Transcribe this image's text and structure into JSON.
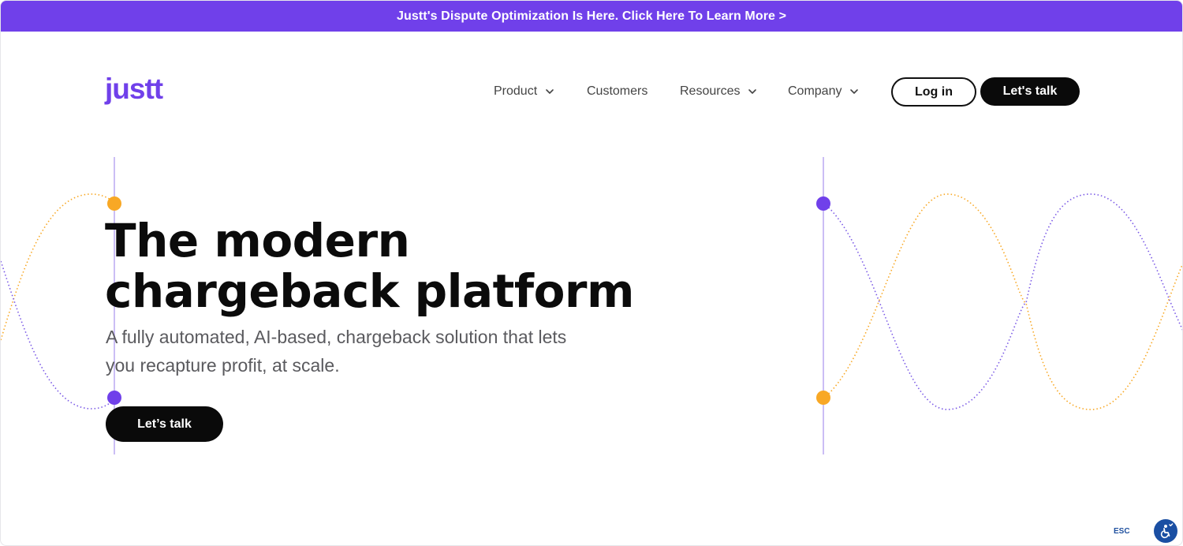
{
  "announcement": {
    "text": "Justt's Dispute Optimization Is Here. Click Here To Learn More >"
  },
  "header": {
    "logo": "justt",
    "nav": [
      {
        "label": "Product",
        "has_dropdown": true
      },
      {
        "label": "Customers",
        "has_dropdown": false
      },
      {
        "label": "Resources",
        "has_dropdown": true
      },
      {
        "label": "Company",
        "has_dropdown": true
      }
    ],
    "login_label": "Log in",
    "cta_label": "Let's talk"
  },
  "hero": {
    "title_line1": "The modern",
    "title_line2": "chargeback platform",
    "subtitle_line1": "A fully automated, AI-based, chargeback solution that lets",
    "subtitle_line2": "you recapture profit, at scale.",
    "cta_label": "Let’s talk"
  },
  "accessibility": {
    "esc_label": "ESC",
    "icon": "accessibility-icon"
  },
  "colors": {
    "brand_purple": "#7040ea",
    "accent_orange": "#f8a825",
    "text_dark": "#0b0b0b",
    "text_muted": "#5a5a5e",
    "button_dark": "#0a0a0a",
    "a11y_blue": "#1a4fa3"
  }
}
